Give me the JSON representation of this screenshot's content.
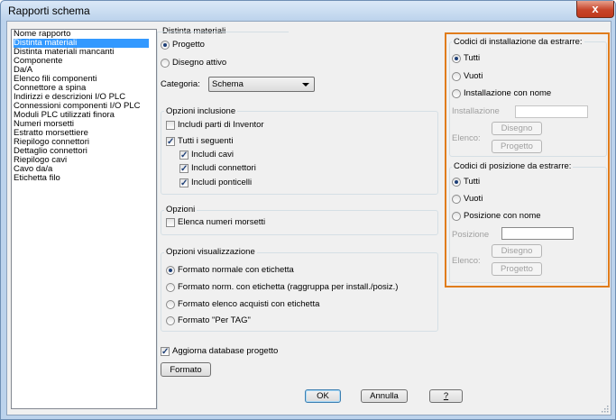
{
  "window": {
    "title": "Rapporti schema",
    "close_label": "x"
  },
  "report_list": {
    "header": "Nome rapporto",
    "items": [
      "Distinta materiali",
      "Distinta materiali mancanti",
      "Componente",
      "Da/A",
      "Elenco fili componenti",
      "Connettore a spina",
      "Indirizzi e descrizioni I/O PLC",
      "Connessioni componenti I/O PLC",
      "Moduli PLC utilizzati finora",
      "Numeri morsetti",
      "Estratto morsettiere",
      "Riepilogo connettori",
      "Dettaglio connettori",
      "Riepilogo cavi",
      "Cavo da/a",
      "Etichetta filo"
    ],
    "selected": "Distinta materiali"
  },
  "distinta": {
    "label": "Distinta materiali",
    "progetto": "Progetto",
    "disegno_attivo": "Disegno attivo",
    "categoria_label": "Categoria:",
    "categoria_value": "Schema"
  },
  "opzioni_inclusione": {
    "label": "Opzioni inclusione",
    "includi_inventor": "Includi parti di Inventor",
    "tutti_seguenti": "Tutti i seguenti",
    "includi_cavi": "Includi cavi",
    "includi_connettori": "Includi connettori",
    "includi_ponticelli": "Includi ponticelli"
  },
  "opzioni": {
    "label": "Opzioni",
    "elenca_morsetti": "Elenca numeri morsetti"
  },
  "visualizzazione": {
    "label": "Opzioni visualizzazione",
    "opt1": "Formato normale con etichetta",
    "opt2": "Formato norm. con etichetta (raggruppa per install./posiz.)",
    "opt3": "Formato elenco acquisti con etichetta",
    "opt4": "Formato \"Per TAG\""
  },
  "aggiorna": "Aggiorna database progetto",
  "formato_button": "Formato",
  "installazione": {
    "label": "Codici di installazione da estrarre:",
    "tutti": "Tutti",
    "vuoti": "Vuoti",
    "con_nome": "Installazione con nome",
    "field_label": "Installazione",
    "disegno": "Disegno",
    "elenco": "Elenco:",
    "progetto": "Progetto"
  },
  "posizione": {
    "label": "Codici di posizione da estrarre:",
    "tutti": "Tutti",
    "vuoti": "Vuoti",
    "con_nome": "Posizione con nome",
    "field_label": "Posizione",
    "disegno": "Disegno",
    "elenco": "Elenco:",
    "progetto": "Progetto"
  },
  "footer": {
    "ok": "OK",
    "annulla": "Annulla",
    "help": "?"
  },
  "colors": {
    "highlight": "#e07c1c",
    "selection": "#3399ff"
  }
}
